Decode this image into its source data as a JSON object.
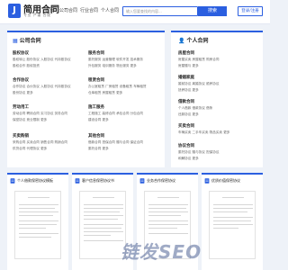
{
  "brand": {
    "logo_letter": "J",
    "name": "简用合同",
    "slogan": "专业  严谨  合规"
  },
  "nav": [
    "首页",
    "公司合同",
    "行业合同",
    "个人合同"
  ],
  "search": {
    "placeholder": "输入您要查找的内容...",
    "button": "搜索"
  },
  "login_label": "登录/注册",
  "left_panel": {
    "title": "公司合同",
    "categories": [
      {
        "name": "股权协议",
        "links": [
          "股权转让",
          "股份协议",
          "入股协议",
          "代持股协议",
          "股权合作",
          "股权投资"
        ]
      },
      {
        "name": "服务合同",
        "links": [
          "委托服务",
          "运营管理",
          "软件开发",
          "技术服务",
          "外包服务",
          "培训服务",
          "物业服务",
          "更多"
        ]
      },
      {
        "name": "合作协议",
        "links": [
          "合作协议",
          "合伙协议",
          "入股协议",
          "代持股协议",
          "股份协议",
          "更多"
        ]
      },
      {
        "name": "租赁合同",
        "links": [
          "办公室租赁",
          "厂房租赁",
          "设备租赁",
          "车辆租赁",
          "仓库租赁",
          "房屋租赁",
          "更多"
        ]
      },
      {
        "name": "劳动用工",
        "links": [
          "劳动合同",
          "聘用合同",
          "实习协议",
          "劳务合同",
          "保密协议",
          "竞业限制",
          "更多"
        ]
      },
      {
        "name": "施工服务",
        "links": [
          "工程施工",
          "装修合同",
          "承包合同",
          "分包合同",
          "建设合同",
          "更多"
        ]
      },
      {
        "name": "买卖购销",
        "links": [
          "采购合同",
          "买卖合同",
          "销售合同",
          "购销合同",
          "供货合同",
          "代理协议",
          "更多"
        ]
      },
      {
        "name": "其他合同",
        "links": [
          "借款合同",
          "担保合同",
          "赠与合同",
          "保证合同",
          "委托合同",
          "更多"
        ]
      }
    ]
  },
  "right_panel": {
    "title": "个人合同",
    "categories": [
      {
        "name": "房屋合同",
        "links": [
          "房屋买卖",
          "房屋租赁",
          "购房合同",
          "房屋赠与",
          "更多"
        ]
      },
      {
        "name": "婚姻家庭",
        "links": [
          "婚前协议",
          "离婚协议",
          "赡养协议",
          "抚养协议",
          "更多"
        ]
      },
      {
        "name": "借款合同",
        "links": [
          "个人借款",
          "借款协议",
          "借条",
          "还款协议",
          "更多"
        ]
      },
      {
        "name": "买卖合同",
        "links": [
          "车辆买卖",
          "二手车买卖",
          "物品买卖",
          "更多"
        ]
      },
      {
        "name": "协议合同",
        "links": [
          "委托协议",
          "赠与协议",
          "担保协议",
          "和解协议",
          "更多"
        ]
      }
    ]
  },
  "docs": [
    {
      "title": "个人借款保密协议模板"
    },
    {
      "title": "客户信息保密协议书"
    },
    {
      "title": "业务合作保密协议"
    },
    {
      "title": "优质价值保密协议"
    }
  ],
  "watermark": "链发SEO",
  "colors": {
    "accent": "#2b5fe0",
    "background": "#eef2f8"
  }
}
